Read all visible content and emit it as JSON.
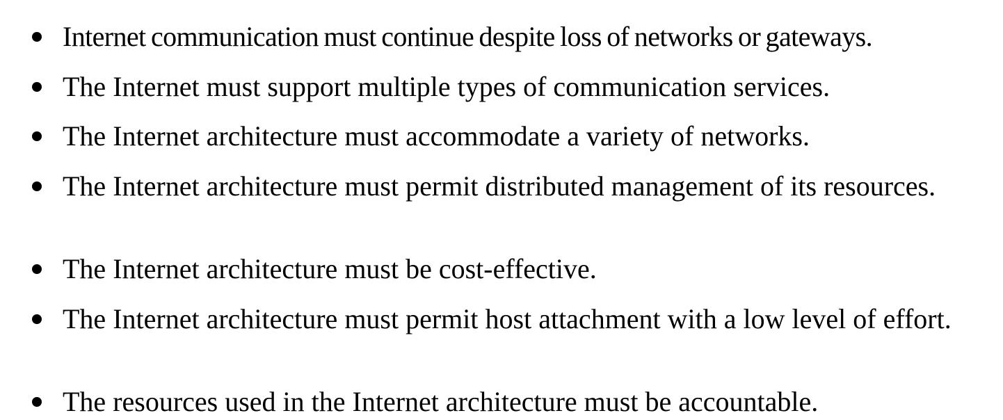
{
  "document": {
    "items": [
      {
        "text": "Internet communication must continue despite loss of networks or gateways."
      },
      {
        "text": "The Internet must support multiple types of communication services."
      },
      {
        "text": "The Internet architecture must accommodate a variety of networks."
      },
      {
        "text": "The Internet architecture must permit distributed management of its resources."
      },
      {
        "text": "The Internet architecture must be cost-effective."
      },
      {
        "text": "The Internet architecture must permit host attachment with a low level of effort."
      },
      {
        "text": "The resources used in the Internet architecture must be accountable."
      }
    ]
  }
}
